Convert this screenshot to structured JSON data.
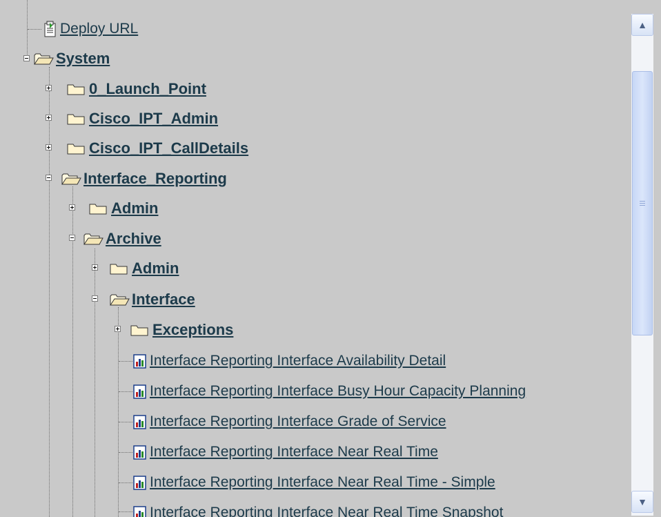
{
  "tree": {
    "deploy_url": "Deploy URL",
    "system": "System",
    "launch_point": "0_Launch_Point",
    "cisco_ipt_admin": "Cisco_IPT_Admin",
    "cisco_ipt_calldetails": "Cisco_IPT_CallDetails",
    "interface_reporting": "Interface_Reporting",
    "admin": "Admin",
    "archive": "Archive",
    "archive_admin": "Admin",
    "interface": "Interface",
    "exceptions": "Exceptions",
    "reports": [
      "Interface Reporting Interface Availability Detail",
      "Interface Reporting Interface Busy Hour Capacity Planning",
      "Interface Reporting Interface Grade of Service",
      "Interface Reporting Interface Near Real Time",
      "Interface Reporting Interface Near Real Time - Simple",
      "Interface Reporting Interface Near Real Time Snapshot"
    ]
  },
  "scrollbar": {
    "up_glyph": "▲",
    "down_glyph": "▼"
  },
  "colors": {
    "background": "#c9c9c9",
    "link": "#1c3a4a",
    "scroll_thumb": "#c7d7f6"
  }
}
